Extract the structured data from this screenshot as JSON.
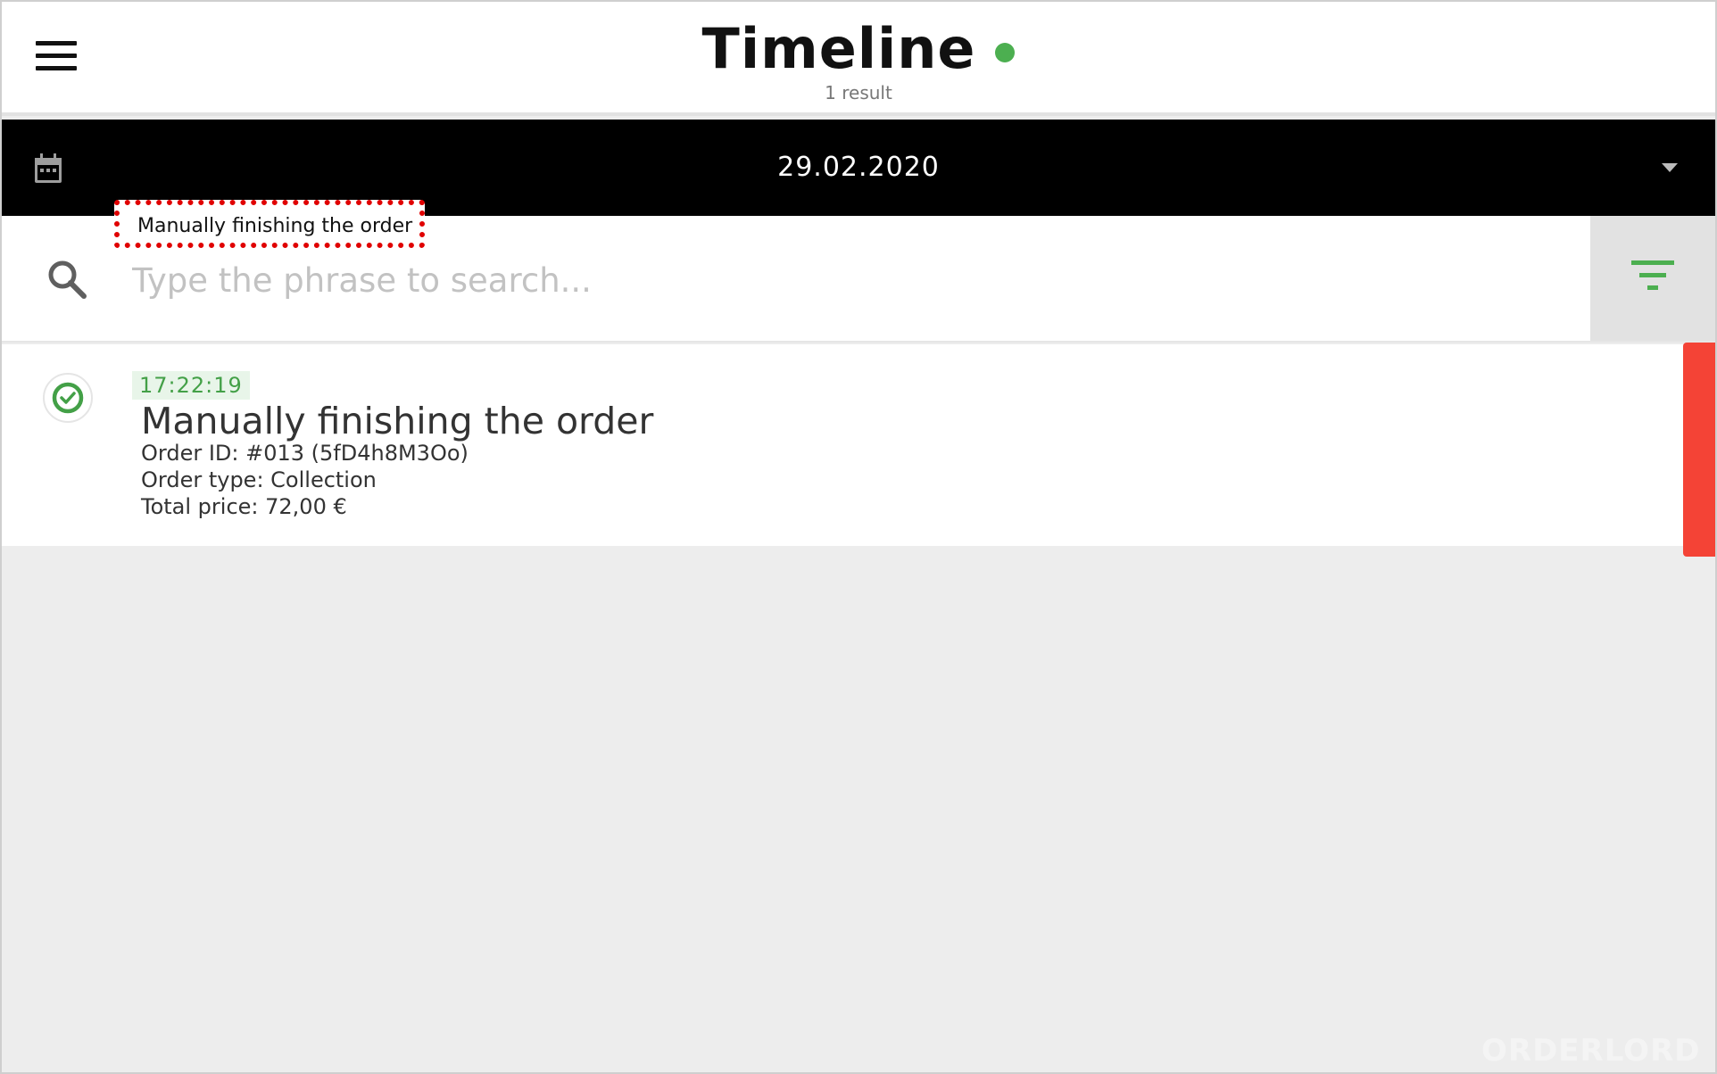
{
  "header": {
    "title": "Timeline",
    "result_count": "1 result",
    "status_color": "#4caf50"
  },
  "date_picker": {
    "date": "29.02.2020"
  },
  "search": {
    "placeholder": "Type the phrase to search...",
    "value": ""
  },
  "tooltip": {
    "text": "Manually finishing the order"
  },
  "timeline": {
    "entries": [
      {
        "time": "17:22:19",
        "title": "Manually finishing the order",
        "order_id": "Order ID: #013 (5fD4h8M3Oo)",
        "order_type": "Order type: Collection",
        "total_price": "Total price: 72,00 €",
        "status": "check-circle-icon",
        "marker_color": "#f44336"
      }
    ]
  },
  "watermark": "ORDERLORD"
}
